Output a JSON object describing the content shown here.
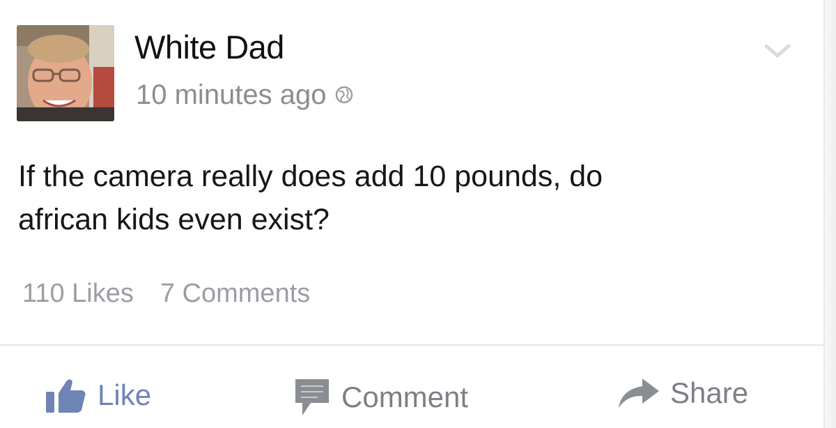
{
  "post": {
    "author": "White Dad",
    "timestamp": "10 minutes ago",
    "privacy_icon": "globe-icon",
    "text_line1": "If the camera really does add 10 pounds, do",
    "text_line2": "african kids even exist?",
    "likes": "110 Likes",
    "comments": "7 Comments"
  },
  "actions": {
    "like_label": "Like",
    "comment_label": "Comment",
    "share_label": "Share"
  },
  "colors": {
    "like_blue": "#6d84b4",
    "muted_gray": "#8a8d91"
  }
}
